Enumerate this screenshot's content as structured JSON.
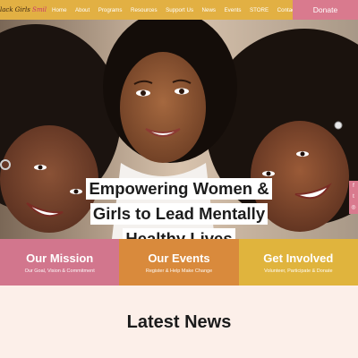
{
  "header": {
    "logo_main": "lack Girls",
    "logo_accent": "Smile",
    "nav": [
      "Home",
      "About",
      "Programs",
      "Resources",
      "Support Us",
      "News",
      "Events",
      "STORE",
      "Contact"
    ],
    "donate_label": "Donate"
  },
  "hero": {
    "headline_lines": [
      "Empowering Women &",
      "Girls to Lead Mentally",
      "Healthy Lives"
    ],
    "social": [
      "f",
      "t",
      "ig"
    ]
  },
  "tiles": [
    {
      "title": "Our Mission",
      "subtitle": "Our Goal, Vision & Commitment"
    },
    {
      "title": "Our Events",
      "subtitle": "Register & Help Make Change"
    },
    {
      "title": "Get Involved",
      "subtitle": "Volunteer, Participate & Donate"
    }
  ],
  "news": {
    "title": "Latest News"
  },
  "colors": {
    "header": "#e2b043",
    "donate": "#d97a8e",
    "mission": "#d2768d",
    "events": "#d98a3c",
    "involved": "#e0b43d",
    "news_bg": "#fcefe9"
  }
}
